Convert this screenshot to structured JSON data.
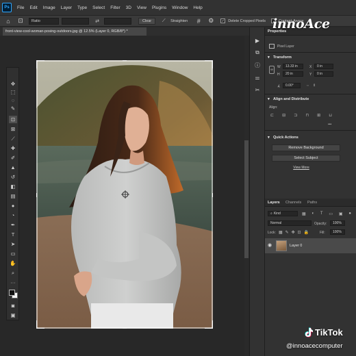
{
  "app": {
    "logo_text": "Ps",
    "menu": [
      "File",
      "Edit",
      "Image",
      "Layer",
      "Type",
      "Select",
      "Filter",
      "3D",
      "View",
      "Plugins",
      "Window",
      "Help"
    ]
  },
  "options_bar": {
    "ratio_label": "Ratio",
    "clear_label": "Clear",
    "straighten_label": "Straighten",
    "delete_cropped_label": "Delete Cropped Pixels",
    "delete_cropped_checked": true,
    "content_aware_label": "Content-Aware"
  },
  "document": {
    "tab_title": "front-view-cool-woman-posing-outdoors.jpg @ 12.5% (Layer 0, RGB/8*) *"
  },
  "properties": {
    "tab_label": "Properties",
    "layer_type": "Pixel Layer",
    "transform_title": "Transform",
    "w_label": "W",
    "w_value": "13.33 in",
    "h_label": "H",
    "h_value": "20 in",
    "x_value": "0 in",
    "y_value": "0 in",
    "angle_value": "0.00°",
    "align_title": "Align and Distribute",
    "align_sub": "Align:",
    "quick_actions_title": "Quick Actions",
    "remove_bg_label": "Remove Background",
    "select_subject_label": "Select Subject",
    "view_more_label": "View More"
  },
  "layers": {
    "tabs": [
      "Layers",
      "Channels",
      "Paths"
    ],
    "kind_label": "Kind",
    "blend_mode": "Normal",
    "opacity_label": "Opacity:",
    "opacity_value": "100%",
    "lock_label": "Lock:",
    "fill_label": "Fill:",
    "fill_value": "100%",
    "layer_name": "Layer 0"
  },
  "overlay": {
    "watermark": "innoAce",
    "tiktok_word": "TikTok",
    "tiktok_handle": "@innoacecomputer"
  },
  "colors": {
    "ps_blue": "#31a8ff",
    "foreground": "#111111",
    "background": "#f5f5f5"
  },
  "icons": {
    "left_tools": [
      "move-icon",
      "marquee-icon",
      "lasso-icon",
      "quick-select-icon",
      "crop-icon",
      "frame-icon",
      "eyedropper-icon",
      "healing-brush-icon",
      "brush-icon",
      "clone-stamp-icon",
      "history-brush-icon",
      "eraser-icon",
      "gradient-icon",
      "blur-icon",
      "dodge-icon",
      "pen-icon",
      "type-icon",
      "path-select-icon",
      "rectangle-icon",
      "hand-icon",
      "zoom-icon",
      "more-tools-icon"
    ]
  }
}
